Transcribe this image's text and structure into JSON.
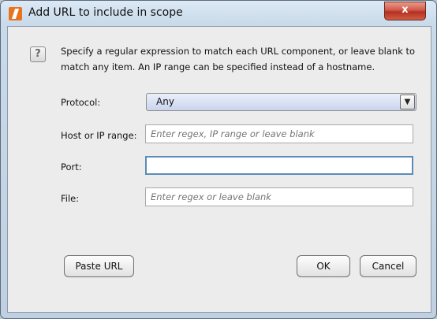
{
  "window": {
    "title": "Add URL to include in scope",
    "close_label": "x"
  },
  "help": {
    "icon": "?"
  },
  "description": "Specify a regular expression to match each URL component, or leave blank to match any item. An IP range can be specified instead of a hostname.",
  "fields": {
    "protocol_label": "Protocol:",
    "protocol_value": "Any",
    "host_label": "Host or IP range:",
    "host_placeholder": "Enter regex, IP range or leave blank",
    "port_label": "Port:",
    "port_value": "",
    "file_label": "File:",
    "file_placeholder": "Enter regex or leave blank"
  },
  "buttons": {
    "paste_url": "Paste URL",
    "ok": "OK",
    "cancel": "Cancel"
  },
  "colors": {
    "title_bar": "#c9daea",
    "close_button": "#c8473a",
    "focus_border": "#5b8db8"
  }
}
